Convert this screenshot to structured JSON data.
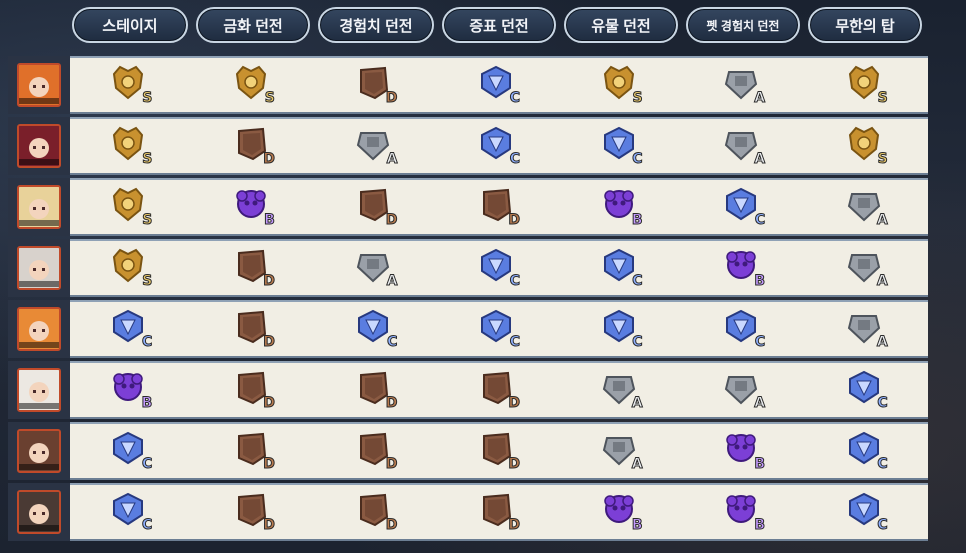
{
  "tabs": [
    {
      "label": "스테이지",
      "w": 116,
      "small": false
    },
    {
      "label": "금화 던전",
      "w": 114,
      "small": false
    },
    {
      "label": "경험치 던전",
      "w": 116,
      "small": false
    },
    {
      "label": "증표 던전",
      "w": 114,
      "small": false
    },
    {
      "label": "유물 던전",
      "w": 114,
      "small": false
    },
    {
      "label": "펫 경험치 던전",
      "w": 114,
      "small": true
    },
    {
      "label": "무한의 탑",
      "w": 114,
      "small": false
    }
  ],
  "rank_styles": {
    "S": {
      "fill": "#c8912f",
      "dark": "#7a5412",
      "letter": "#e7c76a"
    },
    "A": {
      "fill": "#9aa0a8",
      "dark": "#4e545c",
      "letter": "#eef0f2"
    },
    "B": {
      "fill": "#7c3fd6",
      "dark": "#3f1a7d",
      "letter": "#c59bff"
    },
    "C": {
      "fill": "#5a7de0",
      "dark": "#27397f",
      "letter": "#8fb0ff"
    },
    "D": {
      "fill": "#8a5a42",
      "dark": "#4a2c1e",
      "letter": "#b87b4f"
    }
  },
  "rows": [
    {
      "hair": "#e0702a",
      "ranks": [
        "S",
        "S",
        "D",
        "C",
        "S",
        "A",
        "S"
      ]
    },
    {
      "hair": "#7a1f2a",
      "ranks": [
        "S",
        "D",
        "A",
        "C",
        "C",
        "A",
        "S"
      ]
    },
    {
      "hair": "#e8d29a",
      "ranks": [
        "S",
        "B",
        "D",
        "D",
        "B",
        "C",
        "A"
      ]
    },
    {
      "hair": "#d8d2cc",
      "ranks": [
        "S",
        "D",
        "A",
        "C",
        "C",
        "B",
        "A"
      ]
    },
    {
      "hair": "#e88a36",
      "ranks": [
        "C",
        "D",
        "C",
        "C",
        "C",
        "C",
        "A"
      ]
    },
    {
      "hair": "#ece8e2",
      "ranks": [
        "B",
        "D",
        "D",
        "D",
        "A",
        "A",
        "C"
      ]
    },
    {
      "hair": "#6a4030",
      "ranks": [
        "C",
        "D",
        "D",
        "D",
        "A",
        "B",
        "C"
      ]
    },
    {
      "hair": "#4a3a34",
      "ranks": [
        "C",
        "D",
        "D",
        "D",
        "B",
        "B",
        "C"
      ]
    }
  ]
}
